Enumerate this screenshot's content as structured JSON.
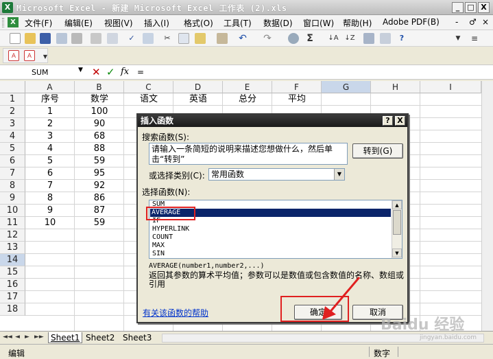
{
  "window": {
    "title": "Microsoft Excel - 新建 Microsoft Excel 工作表 (2).xls",
    "app_icon": "X",
    "controls": [
      "_",
      "□",
      "X"
    ]
  },
  "menu": {
    "items": [
      "文件(F)",
      "编辑(E)",
      "视图(V)",
      "插入(I)",
      "格式(O)",
      "工具(T)",
      "数据(D)",
      "窗口(W)",
      "帮助(H)",
      "Adobe PDF(B)"
    ],
    "right_controls": [
      "-",
      "♂",
      "×"
    ]
  },
  "formula_bar": {
    "name_box": "SUM",
    "cancel": "✕",
    "enter": "✓",
    "fx": "fx",
    "value": "="
  },
  "sheet": {
    "columns": [
      "A",
      "B",
      "C",
      "D",
      "E",
      "F",
      "G",
      "H",
      "I"
    ],
    "rows": [
      "1",
      "2",
      "3",
      "4",
      "5",
      "6",
      "7",
      "8",
      "9",
      "10",
      "11",
      "12",
      "13",
      "14",
      "15",
      "16",
      "17",
      "18"
    ],
    "headers": [
      "序号",
      "数学",
      "语文",
      "英语",
      "总分",
      "平均"
    ],
    "data": [
      [
        "1",
        "100"
      ],
      [
        "2",
        "90"
      ],
      [
        "3",
        "68"
      ],
      [
        "4",
        "88"
      ],
      [
        "5",
        "59"
      ],
      [
        "6",
        "95"
      ],
      [
        "7",
        "92"
      ],
      [
        "8",
        "86"
      ],
      [
        "9",
        "87"
      ],
      [
        "10",
        "59"
      ]
    ]
  },
  "tabs": {
    "nav": [
      "◄◄",
      "◄",
      "►",
      "►►"
    ],
    "sheets": [
      "Sheet1",
      "Sheet2",
      "Sheet3"
    ]
  },
  "status": {
    "left": "编辑",
    "mode": "数字"
  },
  "dialog": {
    "title": "插入函数",
    "help": "?",
    "close": "X",
    "search_label": "搜索函数(S):",
    "search_text": "请输入一条简短的说明来描述您想做什么，然后单击“转到”",
    "go_button": "转到(G)",
    "category_label": "或选择类别(C):",
    "category_value": "常用函数",
    "select_label": "选择函数(N):",
    "functions": [
      "SUM",
      "AVERAGE",
      "IF",
      "HYPERLINK",
      "COUNT",
      "MAX",
      "SIN"
    ],
    "selected_function": "AVERAGE",
    "syntax": "AVERAGE(number1,number2,...)",
    "description": "返回其参数的算术平均值；参数可以是数值或包含数值的名称、数组或引用",
    "help_link": "有关该函数的帮助",
    "ok_button": "确定",
    "cancel_button": "取消"
  },
  "watermark": {
    "text": "Baidu 经验",
    "sub": "jingyan.baidu.com"
  },
  "colors": {
    "selection": "#0a246a",
    "annotation": "#e02020",
    "link": "#0033cc"
  }
}
